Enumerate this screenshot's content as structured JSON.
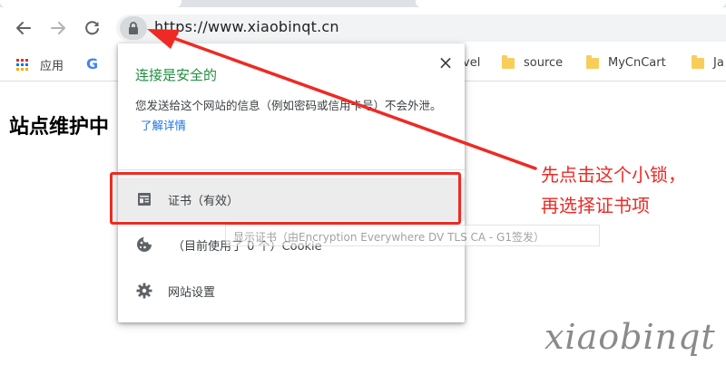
{
  "browser": {
    "url": "https://www.xiaobinqt.cn",
    "icons": {
      "back": "arrow-left-icon",
      "forward": "arrow-right-icon",
      "reload": "reload-icon",
      "lock": "lock-icon"
    }
  },
  "bookmarks": {
    "items": [
      {
        "label": "应用",
        "icon": "apps-grid-icon"
      },
      {
        "label": "G",
        "icon": "google-icon"
      },
      {
        "label": "vel",
        "icon": "folder-icon"
      },
      {
        "label": "source",
        "icon": "folder-icon"
      },
      {
        "label": "MyCnCart",
        "icon": "folder-icon"
      },
      {
        "label": "Ja",
        "icon": "folder-icon"
      }
    ]
  },
  "page": {
    "heading": "站点维护中"
  },
  "popup": {
    "title": "连接是安全的",
    "close_label": "×",
    "description": "您发送给这个网站的信息（例如密码或信用卡号）不会外泄。",
    "learn_more": "了解详情",
    "certificate_label": "证书（有效）",
    "cookie_label": "（目前使用了 0 个）Cookie",
    "site_settings_label": "网站设置"
  },
  "tooltip": {
    "text": "显示证书（由Encryption Everywhere DV TLS CA - G1签发）"
  },
  "annotation": {
    "lines": [
      "先点击这个小锁，",
      "再选择证书项"
    ],
    "color": "#ee2a24"
  },
  "watermark": {
    "text": "xiaobinqt"
  },
  "colors": {
    "secure_green": "#1e8e3e",
    "link_blue": "#1a73e8",
    "annotation_red": "#ee2a24",
    "folder_yellow": "#f9cd5b"
  }
}
